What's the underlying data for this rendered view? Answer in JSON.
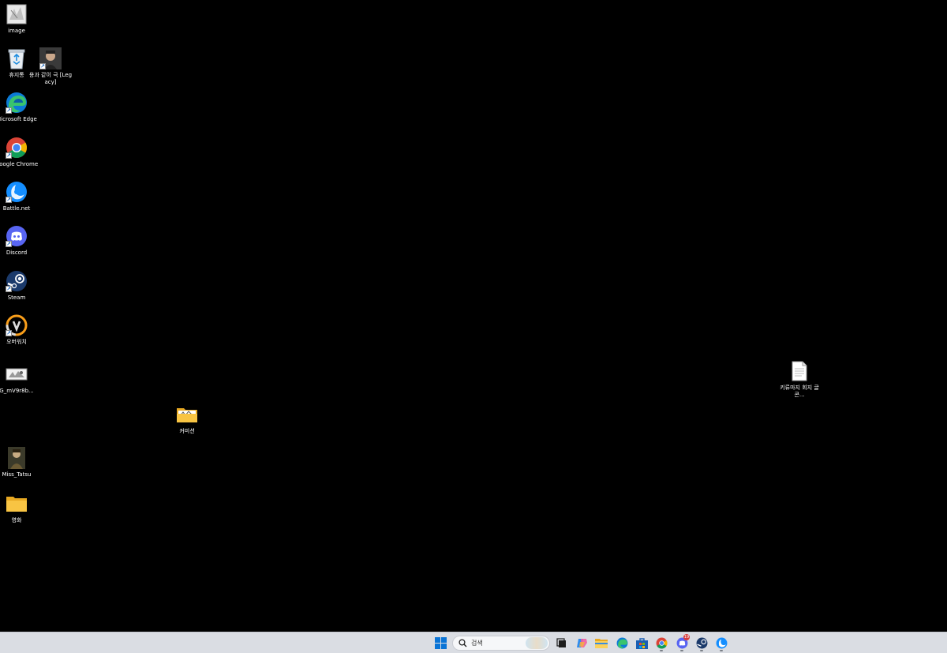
{
  "desktop": {
    "icons": [
      {
        "label": "image"
      },
      {
        "label": "휴지통"
      },
      {
        "label": "용과 같이 극 [Legacy]"
      },
      {
        "label": "Microsoft Edge"
      },
      {
        "label": "Google Chrome"
      },
      {
        "label": "Battle.net"
      },
      {
        "label": "Discord"
      },
      {
        "label": "Steam"
      },
      {
        "label": "오버워치"
      },
      {
        "label": "G_mV9r8b..."
      },
      {
        "label": "커미션"
      },
      {
        "label": "Miss_Tatsu"
      },
      {
        "label": "영화"
      },
      {
        "label": "키류마지 회지 글콘..."
      }
    ]
  },
  "taskbar": {
    "search_placeholder": "검색",
    "discord_badge": "19",
    "apps": [
      "start-icon",
      "search",
      "task-view-icon",
      "copilot-icon",
      "file-explorer-icon",
      "edge-icon",
      "store-icon",
      "chrome-icon",
      "discord-icon",
      "steam-icon",
      "battlenet-icon"
    ]
  },
  "colors": {
    "desktop_bg": "#000000",
    "taskbar_bg": "#dadde3",
    "folder_yellow": "#f8c443",
    "accent_blue": "#0078d4"
  }
}
